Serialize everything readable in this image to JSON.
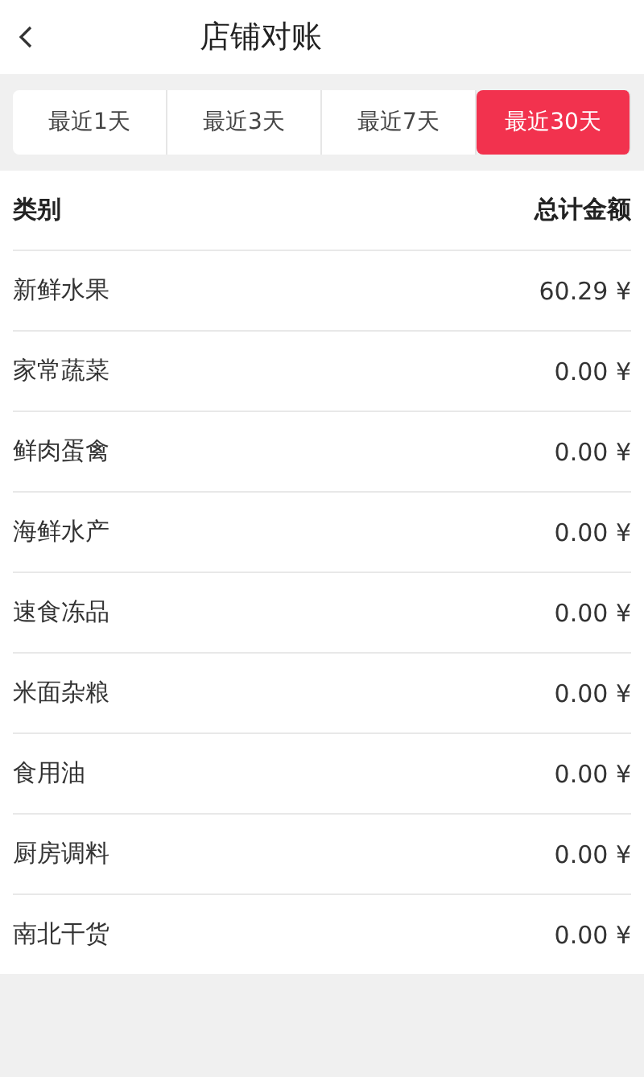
{
  "header": {
    "title": "店铺对账"
  },
  "tabs": [
    {
      "label": "最近1天",
      "selected": false
    },
    {
      "label": "最近3天",
      "selected": false
    },
    {
      "label": "最近7天",
      "selected": false
    },
    {
      "label": "最近30天",
      "selected": true
    }
  ],
  "table": {
    "columns": [
      "类别",
      "总计金额"
    ],
    "rows": [
      {
        "category": "新鲜水果",
        "amount": "60.29 ¥"
      },
      {
        "category": "家常蔬菜",
        "amount": "0.00 ¥"
      },
      {
        "category": "鲜肉蛋禽",
        "amount": "0.00 ¥"
      },
      {
        "category": "海鲜水产",
        "amount": "0.00 ¥"
      },
      {
        "category": "速食冻品",
        "amount": "0.00 ¥"
      },
      {
        "category": "米面杂粮",
        "amount": "0.00 ¥"
      },
      {
        "category": "食用油",
        "amount": "0.00 ¥"
      },
      {
        "category": "厨房调料",
        "amount": "0.00 ¥"
      },
      {
        "category": "南北干货",
        "amount": "0.00 ¥"
      }
    ]
  }
}
